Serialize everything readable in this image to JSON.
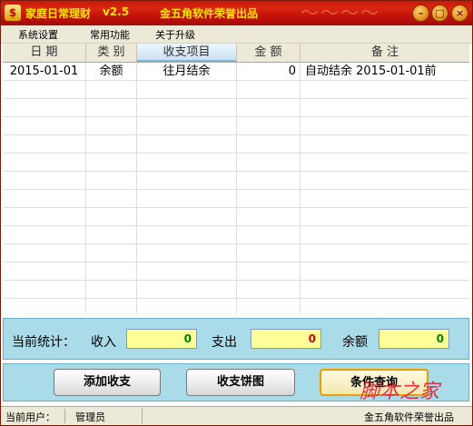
{
  "window": {
    "title": "家庭日常理财",
    "version": "v2.5",
    "slogan": "金五角软件荣誉出品"
  },
  "menu": [
    "系统设置",
    "常用功能",
    "关于升级"
  ],
  "table": {
    "headers": [
      "日 期",
      "类 别",
      "收支项目",
      "金 额",
      "备 注"
    ],
    "rows": [
      [
        "2015-01-01",
        "余额",
        "往月结余",
        "0",
        "自动结余 2015-01-01前"
      ]
    ]
  },
  "stats": {
    "title": "当前统计：",
    "income_label": "收入",
    "income_value": "0",
    "expense_label": "支出",
    "expense_value": "0",
    "balance_label": "余额",
    "balance_value": "0",
    "colors": {
      "income": "#008000",
      "expense": "#cc0000",
      "balance": "#008000",
      "box": "#ffff99"
    }
  },
  "buttons": {
    "add": "添加收支",
    "pie": "收支饼图",
    "query": "条件查询"
  },
  "status": {
    "user_label": "当前用户：",
    "user": "管理员",
    "right_text": "金五角软件荣誉出品"
  },
  "watermark": "脚本之家",
  "icons": [
    "app-icon",
    "minimize-icon",
    "maximize-icon",
    "close-icon"
  ]
}
